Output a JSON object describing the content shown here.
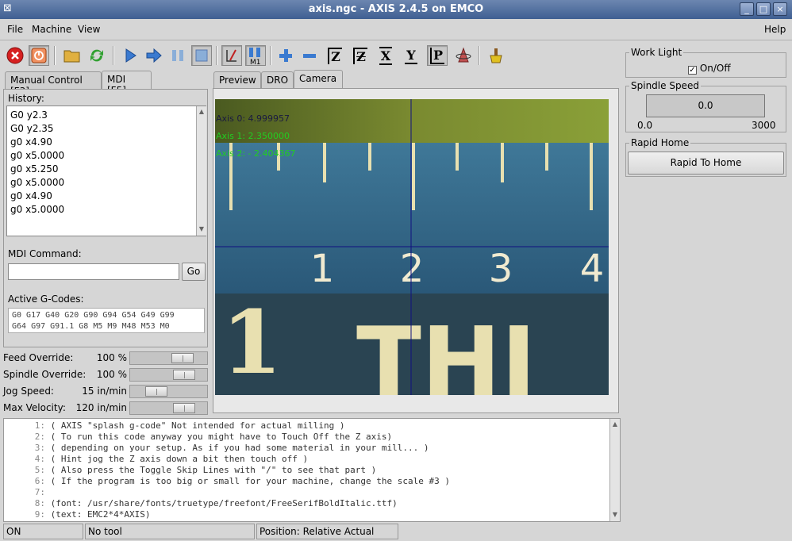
{
  "window": {
    "title": "axis.ngc - AXIS 2.4.5 on EMCO",
    "buttons": {
      "minimize": "_",
      "maximize": "□",
      "close": "×"
    }
  },
  "menubar": {
    "file": "File",
    "machine": "Machine",
    "view": "View",
    "help": "Help"
  },
  "toolbar": {
    "icons": [
      "estop-icon",
      "machine-power-icon",
      "open-file-icon",
      "reload-icon",
      "run-icon",
      "step-icon",
      "pause-icon",
      "stop-icon",
      "block-delete-icon",
      "optional-stop-icon",
      "zoom-in-icon",
      "zoom-out-icon",
      "view-z-icon",
      "view-z2-icon",
      "view-x-icon",
      "view-y-icon",
      "view-p-icon",
      "rotate-icon",
      "clear-plot-icon"
    ],
    "axis_labels": {
      "z": "Z",
      "z2": "Z",
      "x": "X",
      "y": "Y",
      "p": "P",
      "m1": "M1"
    }
  },
  "left_tabs": [
    {
      "label": "Manual Control [F3]"
    },
    {
      "label": "MDI [F5]"
    }
  ],
  "mdi": {
    "history_label": "History:",
    "history": [
      "G0 y2.3",
      "G0 y2.35",
      "g0 x4.90",
      "g0 x5.0000",
      "g0 x5.250",
      "g0 x5.0000",
      "g0 x4.90",
      "g0 x5.0000"
    ],
    "command_label": "MDI Command:",
    "command_value": "",
    "go_label": "Go",
    "active_gcodes_label": "Active G-Codes:",
    "active_gcodes_line1": "G0 G17 G40 G20 G90 G94 G54 G49 G99",
    "active_gcodes_line2": "G64 G97 G91.1 G8 M5 M9 M48 M53 M0"
  },
  "overrides": [
    {
      "label": "Feed Override:",
      "value": "100 %",
      "fraction": 0.75
    },
    {
      "label": "Spindle Override:",
      "value": "100 %",
      "fraction": 0.78
    },
    {
      "label": "Jog Speed:",
      "value": "15 in/min",
      "fraction": 0.28
    },
    {
      "label": "Max Velocity:",
      "value": "120 in/min",
      "fraction": 0.78
    }
  ],
  "view_tabs": [
    {
      "label": "Preview"
    },
    {
      "label": "DRO"
    },
    {
      "label": "Camera"
    }
  ],
  "camera": {
    "axis0": "Axis 0: 4.999957",
    "axis1": "Axis 1: 2.350000",
    "axis2": "Axis 2: - 2.404367",
    "ruler_numbers": [
      "1",
      "2",
      "3",
      "4"
    ],
    "letters": "THI",
    "big_one": "1"
  },
  "right_panel": {
    "work_light_title": "Work Light",
    "work_light_checkbox": "On/Off",
    "work_light_checked": true,
    "spindle_speed_title": "Spindle Speed",
    "spindle_speed_value": "0.0",
    "spindle_min": "0.0",
    "spindle_max": "3000",
    "rapid_home_title": "Rapid Home",
    "rapid_home_button": "Rapid To Home"
  },
  "gcode_lines": [
    {
      "n": "1:",
      "text": "( AXIS \"splash g-code\" Not intended for actual milling )"
    },
    {
      "n": "2:",
      "text": "( To run this code anyway you might have to Touch Off the Z axis)"
    },
    {
      "n": "3:",
      "text": "( depending on your setup. As if you had some material in your mill... )"
    },
    {
      "n": "4:",
      "text": "( Hint jog the Z axis down a bit then touch off )"
    },
    {
      "n": "5:",
      "text": "( Also press the Toggle Skip Lines with \"/\" to see that part )"
    },
    {
      "n": "6:",
      "text": "( If the program is too big or small for your machine, change the scale #3 )"
    },
    {
      "n": "7:",
      "text": ""
    },
    {
      "n": "8:",
      "text": "(font: /usr/share/fonts/truetype/freefont/FreeSerifBoldItalic.ttf)"
    },
    {
      "n": "9:",
      "text": "(text: EMC2*4*AXIS)"
    }
  ],
  "statusbar": {
    "state": "ON",
    "tool": "No tool",
    "position": "Position: Relative Actual"
  },
  "colors": {
    "titlebar": "#4a6a9c",
    "dro_text": "#1a1a40",
    "dro_green": "#22cc22",
    "crosshair": "#101080"
  }
}
